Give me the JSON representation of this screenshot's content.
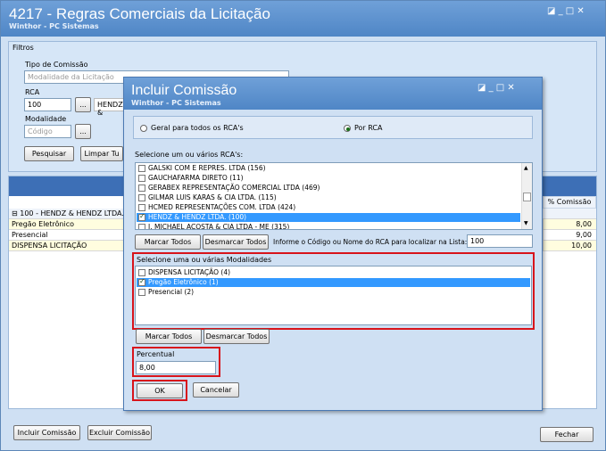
{
  "main": {
    "title": "4217 - Regras Comerciais da Licitação",
    "subtitle": "Winthor - PC Sistemas",
    "filtros_label": "Filtros",
    "tipo_comissao_label": "Tipo de Comissão",
    "tipo_comissao_placeholder": "Modalidade da Licitação",
    "rca_label": "RCA",
    "rca_value": "100",
    "rca_name": "HENDZ &",
    "modalidade_label": "Modalidade",
    "modalidade_placeholder": "Código",
    "ellipsis": "...",
    "pesquisar_label": "Pesquisar",
    "limpar_label": "Limpar Tu",
    "col_comissao": "% Comissão",
    "group_row": "100 - HENDZ & HENDZ LTDA.",
    "rows": [
      {
        "name": "Pregão Eletrônico",
        "value": "8,00"
      },
      {
        "name": "Presencial",
        "value": "9,00"
      },
      {
        "name": "DISPENSA LICITAÇÃO",
        "value": "10,00"
      }
    ],
    "incluir_label": "Incluir Comissão",
    "excluir_label": "Excluir Comissão",
    "fechar_label": "Fechar",
    "win_controls": "◪ _ □ ✕"
  },
  "dialog": {
    "title": "Incluir Comissão",
    "subtitle": "Winthor - PC Sistemas",
    "win_controls": "◪ _ □ ✕",
    "radio_geral": "Geral para todos os RCA's",
    "radio_por_rca": "Por RCA",
    "rca_list_label": "Selecione um ou vários RCA's:",
    "rca_items": [
      {
        "label": "GALSKI COM E REPRES. LTDA (156)",
        "checked": false,
        "selected": false
      },
      {
        "label": "GAUCHAFARMA DIRETO (11)",
        "checked": false,
        "selected": false
      },
      {
        "label": "GERABEX REPRESENTAÇÃO COMERCIAL LTDA (469)",
        "checked": false,
        "selected": false
      },
      {
        "label": "GILMAR LUIS KARAS & CIA LTDA. (115)",
        "checked": false,
        "selected": false
      },
      {
        "label": "HCMED REPRESENTAÇÕES COM. LTDA (424)",
        "checked": false,
        "selected": false
      },
      {
        "label": "HENDZ & HENDZ LTDA. (100)",
        "checked": true,
        "selected": true
      },
      {
        "label": "J. MICHAEL ACOSTA & CIA LTDA - ME (315)",
        "checked": false,
        "selected": false
      }
    ],
    "marcar_todos": "Marcar Todos",
    "desmarcar_todos": "Desmarcar Todos",
    "informe_label": "Informe o Código ou Nome do RCA para localizar na Lista:",
    "informe_value": "100",
    "mod_label": "Selecione uma ou várias Modalidades",
    "mod_items": [
      {
        "label": "DISPENSA LICITAÇÃO (4)",
        "checked": false,
        "selected": false
      },
      {
        "label": "Pregão Eletrônico (1)",
        "checked": true,
        "selected": true
      },
      {
        "label": "Presencial (2)",
        "checked": false,
        "selected": false
      }
    ],
    "percentual_label": "Percentual",
    "percentual_value": "8,00",
    "ok_label": "OK",
    "cancelar_label": "Cancelar"
  },
  "colors": {
    "title_bar": "#4f86c6",
    "selection": "#3399ff",
    "highlight_red": "#d8141b",
    "grid_header": "#3d6fb6"
  }
}
